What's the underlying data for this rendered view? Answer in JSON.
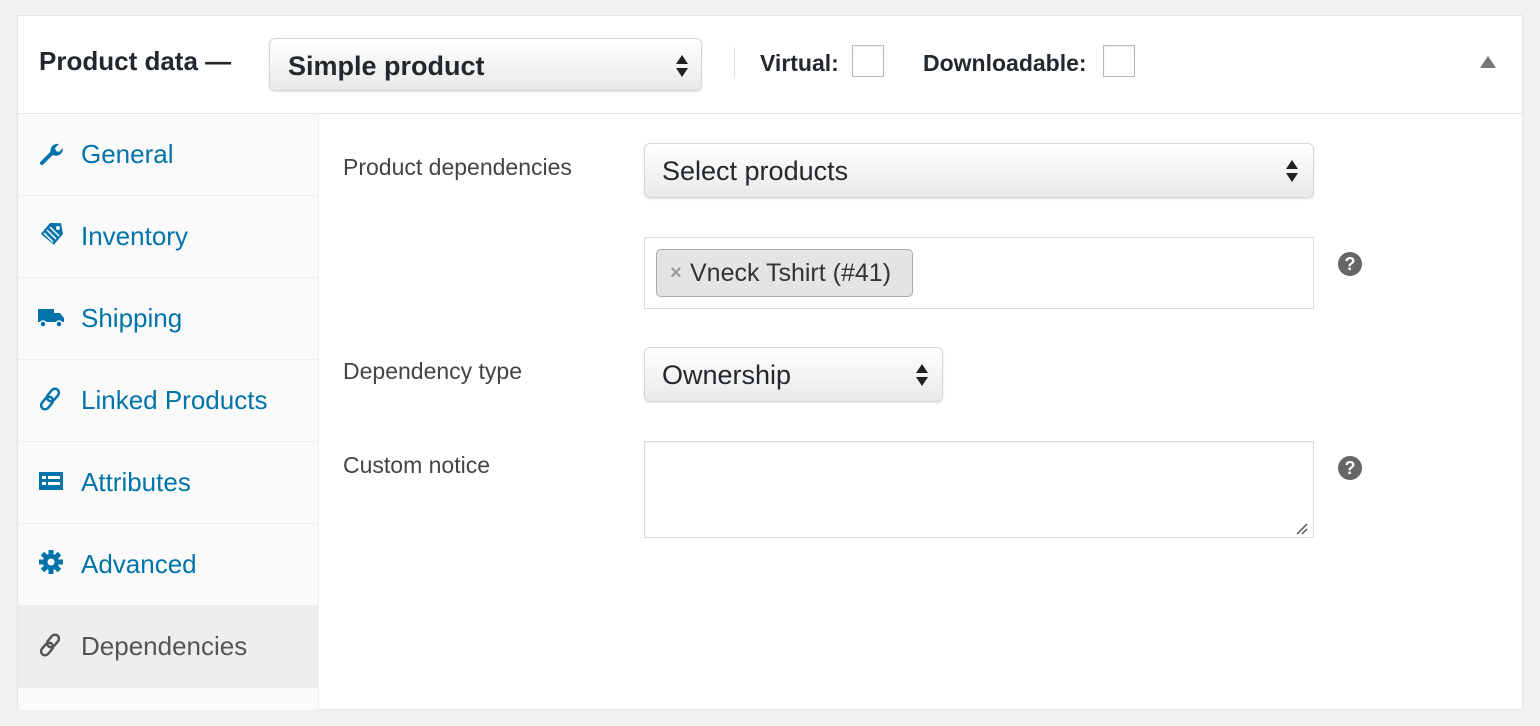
{
  "header": {
    "title": "Product data —",
    "product_type": {
      "selected": "Simple product"
    },
    "virtual_label": "Virtual:",
    "virtual_checked": false,
    "downloadable_label": "Downloadable:",
    "downloadable_checked": false
  },
  "tabs": [
    {
      "label": "General",
      "icon": "wrench-icon",
      "active": false
    },
    {
      "label": "Inventory",
      "icon": "tag-icon",
      "active": false
    },
    {
      "label": "Shipping",
      "icon": "truck-icon",
      "active": false
    },
    {
      "label": "Linked Products",
      "icon": "link-icon",
      "active": false
    },
    {
      "label": "Attributes",
      "icon": "list-icon",
      "active": false
    },
    {
      "label": "Advanced",
      "icon": "gear-icon",
      "active": false
    },
    {
      "label": "Dependencies",
      "icon": "link-icon",
      "active": true
    }
  ],
  "form": {
    "product_dependencies_label": "Product dependencies",
    "product_select_placeholder": "Select products",
    "selected_products": [
      {
        "remove": "×",
        "label": "Vneck Tshirt (#41)"
      }
    ],
    "dependency_type_label": "Dependency type",
    "dependency_type_selected": "Ownership",
    "custom_notice_label": "Custom notice",
    "custom_notice_value": "",
    "help_glyph": "?"
  },
  "colors": {
    "link": "#0073aa",
    "active_tab_bg": "#eeeeee",
    "text": "#23282d"
  }
}
